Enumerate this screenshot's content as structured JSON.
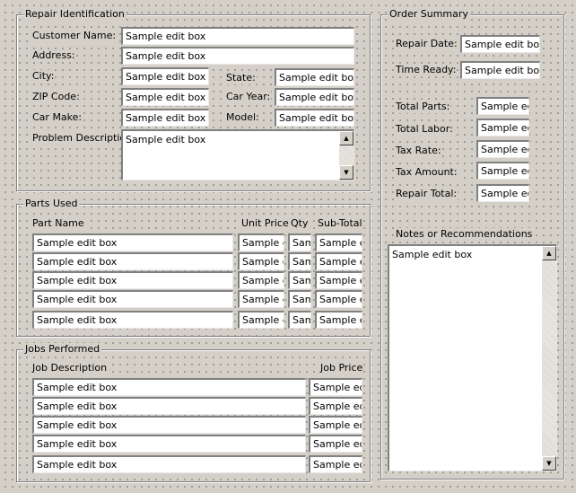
{
  "repair": {
    "title": "Repair Identification",
    "customer_label": "Customer Name:",
    "address_label": "Address:",
    "city_label": "City:",
    "state_label": "State:",
    "zip_label": "ZIP Code:",
    "caryear_label": "Car Year:",
    "carmake_label": "Car Make:",
    "model_label": "Model:",
    "problem_label": "Problem Description:",
    "customer_value": "Sample edit box",
    "address_value": "Sample edit box",
    "city_value": "Sample edit box",
    "state_value": "Sample edit box",
    "zip_value": "Sample edit box",
    "caryear_value": "Sample edit box",
    "carmake_value": "Sample edit box",
    "model_value": "Sample edit box",
    "problem_value": "Sample edit box"
  },
  "parts": {
    "title": "Parts Used",
    "col_name": "Part Name",
    "col_price": "Unit Price",
    "col_qty": "Qty",
    "col_subtotal": "Sub-Total",
    "rows": [
      {
        "name": "Sample edit box",
        "price": "Sample edit box",
        "qty": "Sample edit box",
        "subtotal": "Sample edit box"
      },
      {
        "name": "Sample edit box",
        "price": "Sample edit box",
        "qty": "Sample edit box",
        "subtotal": "Sample edit box"
      },
      {
        "name": "Sample edit box",
        "price": "Sample edit box",
        "qty": "Sample edit box",
        "subtotal": "Sample edit box"
      },
      {
        "name": "Sample edit box",
        "price": "Sample edit box",
        "qty": "Sample edit box",
        "subtotal": "Sample edit box"
      },
      {
        "name": "Sample edit box",
        "price": "Sample edit box",
        "qty": "Sample edit box",
        "subtotal": "Sample edit box"
      }
    ]
  },
  "jobs": {
    "title": "Jobs Performed",
    "col_desc": "Job Description",
    "col_price": "Job Price",
    "rows": [
      {
        "desc": "Sample edit box",
        "price": "Sample edit box"
      },
      {
        "desc": "Sample edit box",
        "price": "Sample edit box"
      },
      {
        "desc": "Sample edit box",
        "price": "Sample edit box"
      },
      {
        "desc": "Sample edit box",
        "price": "Sample edit box"
      },
      {
        "desc": "Sample edit box",
        "price": "Sample edit box"
      }
    ]
  },
  "order": {
    "title": "Order Summary",
    "repair_date_label": "Repair Date:",
    "time_ready_label": "Time Ready:",
    "total_parts_label": "Total Parts:",
    "total_labor_label": "Total Labor:",
    "tax_rate_label": "Tax Rate:",
    "tax_amount_label": "Tax Amount:",
    "repair_total_label": "Repair Total:",
    "repair_date_value": "Sample edit box",
    "time_ready_value": "Sample edit box",
    "total_parts_value": "Sample edit box",
    "total_labor_value": "Sample edit box",
    "tax_rate_value": "Sample edit box",
    "tax_amount_value": "Sample edit box",
    "repair_total_value": "Sample edit box",
    "notes_label": "Notes or Recommendations",
    "notes_value": "Sample edit box"
  },
  "icons": {
    "scroll_up": "▲",
    "scroll_down": "▼"
  }
}
